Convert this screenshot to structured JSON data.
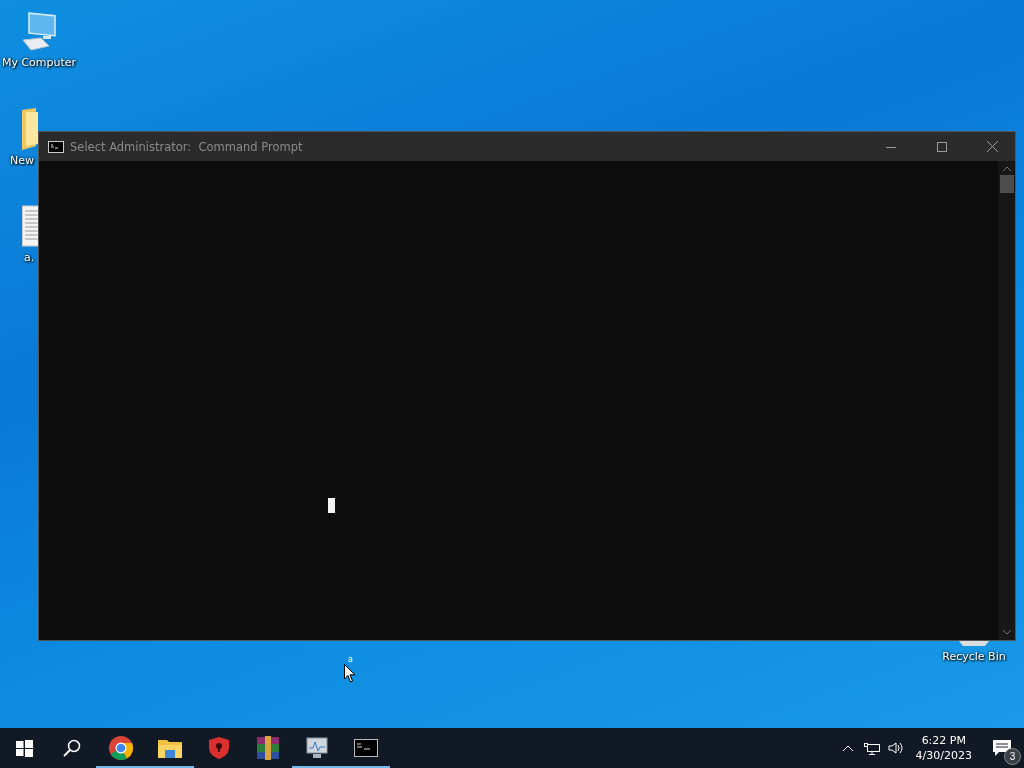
{
  "desktop": {
    "icons": [
      {
        "kind": "computer",
        "label": "My Computer"
      },
      {
        "kind": "folder",
        "label": "New"
      },
      {
        "kind": "document",
        "label": "a."
      },
      {
        "kind": "recycle",
        "label": "Recycle Bin"
      }
    ],
    "cursor": {
      "label": "a"
    }
  },
  "window": {
    "title": "Select Administrator:  Command Prompt",
    "cursor_visible": true
  },
  "taskbar": {
    "apps": [
      {
        "kind": "chrome",
        "running": true
      },
      {
        "kind": "explorer",
        "running": true
      },
      {
        "kind": "shield",
        "running": false
      },
      {
        "kind": "archive",
        "running": false
      },
      {
        "kind": "monitor",
        "running": true
      },
      {
        "kind": "cmd",
        "running": true
      }
    ],
    "clock": {
      "time": "6:22 PM",
      "date": "4/30/2023"
    },
    "notifications": {
      "count": "3"
    }
  }
}
